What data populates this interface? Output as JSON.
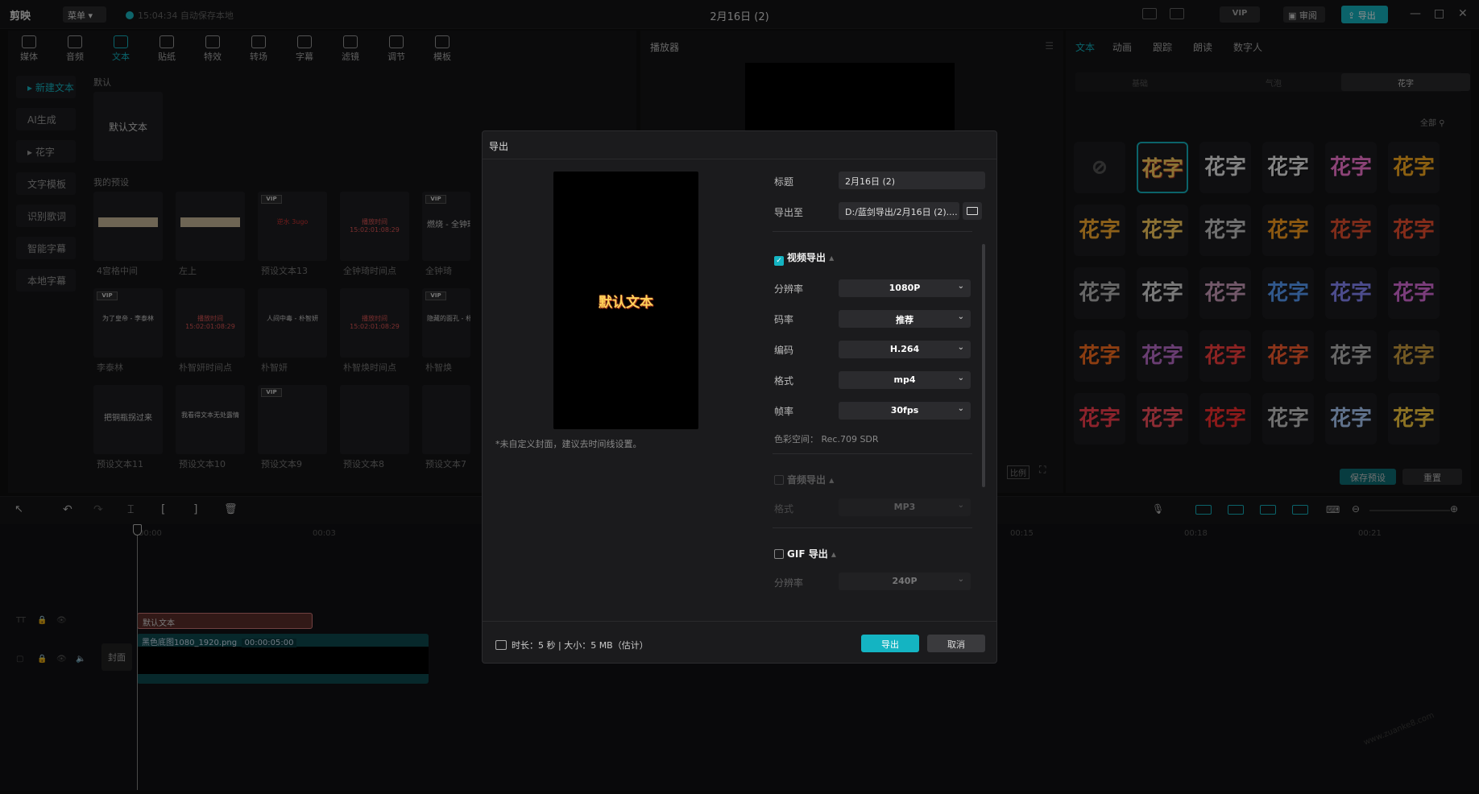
{
  "app": {
    "logo": "剪映",
    "menu_label": "菜单",
    "autosave": "15:04:34 自动保存本地",
    "title": "2月16日 (2)",
    "review": "审阅",
    "export": "导出",
    "vip": "VIP"
  },
  "toolbar": [
    {
      "label": "媒体",
      "icon": "media-icon"
    },
    {
      "label": "音频",
      "icon": "audio-icon"
    },
    {
      "label": "文本",
      "icon": "text-icon",
      "active": true
    },
    {
      "label": "贴纸",
      "icon": "sticker-icon"
    },
    {
      "label": "特效",
      "icon": "effects-icon"
    },
    {
      "label": "转场",
      "icon": "transition-icon"
    },
    {
      "label": "字幕",
      "icon": "subtitle-icon"
    },
    {
      "label": "滤镜",
      "icon": "filter-icon"
    },
    {
      "label": "调节",
      "icon": "adjust-icon"
    },
    {
      "label": "模板",
      "icon": "template-icon"
    }
  ],
  "sidebar": [
    "新建文本",
    "AI生成",
    "花字",
    "文字模板",
    "识别歌词",
    "智能字幕",
    "本地字幕"
  ],
  "library": {
    "default_label": "默认",
    "default_item": "默认文本",
    "presets_label": "我的预设",
    "row1": [
      "4宫格中间",
      "左上",
      "预设文本13",
      "全钟琦时间点",
      "全钟琦"
    ],
    "row1_inner": [
      "",
      "",
      "逆水 3ugo",
      "播放时间 15:02:01:08:29",
      "燃烧 - 全钟琦"
    ],
    "row2": [
      "李泰林",
      "朴智妍时间点",
      "朴智妍",
      "朴智焕时间点",
      "朴智焕"
    ],
    "row2_inner": [
      "为了皇帝 - 李泰林",
      "播放时间 15:02:01:08:29",
      "人间中毒 - 朴智妍",
      "播放时间 15:02:01:08:29",
      "隐藏的面孔 - 朴智焕"
    ],
    "row3": [
      "预设文本11",
      "预设文本10",
      "预设文本9",
      "预设文本8",
      "预设文本7"
    ],
    "row3_inner": [
      "把铜瓶拐过来",
      "我看得文本无处露情",
      "",
      "",
      ""
    ]
  },
  "player": {
    "title": "播放器",
    "ratio_label": "比例"
  },
  "right_panel": {
    "tabs": [
      "文本",
      "动画",
      "跟踪",
      "朗读",
      "数字人"
    ],
    "subtabs": [
      "基础",
      "气泡",
      "花字"
    ],
    "filter_label": "全部",
    "huazi": "花字",
    "save_preset": "保存预设",
    "reset": "重置"
  },
  "timeline": {
    "ticks": [
      "00:00",
      "00:03",
      "00:15",
      "00:18",
      "00:21"
    ],
    "text_clip": "默认文本",
    "video_clip": "黑色底图1080_1920.png",
    "video_duration": "00:00:05:00",
    "cover": "封面"
  },
  "dialog": {
    "title": "导出",
    "preview_text": "默认文本",
    "cover_note": "*未自定义封面，建议去时间线设置。",
    "title_label": "标题",
    "title_value": "2月16日 (2)",
    "export_to_label": "导出至",
    "export_to_value": "D:/蓝剑导出/2月16日 (2)....",
    "video_export": "视频导出",
    "resolution_label": "分辨率",
    "resolution": "1080P",
    "bitrate_label": "码率",
    "bitrate": "推荐",
    "codec_label": "编码",
    "codec": "H.264",
    "format_label": "格式",
    "format": "mp4",
    "framerate_label": "帧率",
    "framerate": "30fps",
    "colorspace_label": "色彩空间：",
    "colorspace": "Rec.709 SDR",
    "audio_export": "音频导出",
    "audio_format_label": "格式",
    "audio_format": "MP3",
    "gif_export": "GIF 导出",
    "gif_resolution_label": "分辨率",
    "gif_resolution": "240P",
    "footer": "时长：5 秒 | 大小：5 MB（估计）",
    "export_btn": "导出",
    "cancel_btn": "取消"
  },
  "watermark": "www.zuanke8.com",
  "colors": {
    "accent": "#14b4c2",
    "dialog_bg": "#1b1b1d"
  }
}
